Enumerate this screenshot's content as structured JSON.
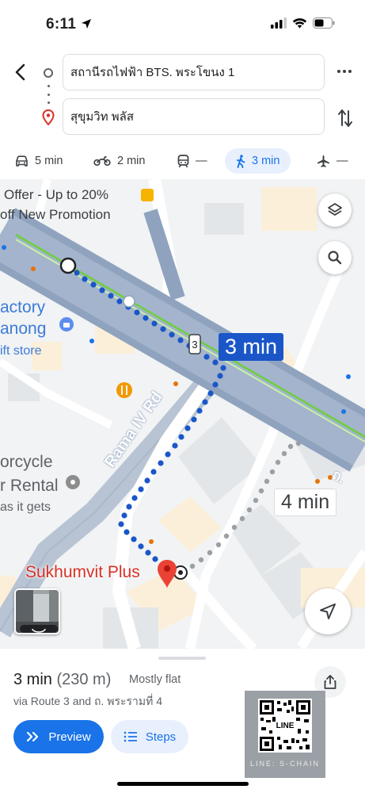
{
  "status": {
    "time": "6:11"
  },
  "directions": {
    "from": "สถานีรถไฟฟ้า BTS. พระโขนง 1",
    "to": "สุขุมวิท พลัส"
  },
  "modes": [
    {
      "name": "drive",
      "label": "5 min",
      "icon": "car-icon"
    },
    {
      "name": "motorcycle",
      "label": "2 min",
      "icon": "motorcycle-icon"
    },
    {
      "name": "transit",
      "label": "—",
      "icon": "train-icon"
    },
    {
      "name": "walk",
      "label": "3 min",
      "icon": "walk-icon",
      "selected": true
    },
    {
      "name": "flight",
      "label": "—",
      "icon": "plane-icon"
    }
  ],
  "map": {
    "labels": {
      "offer_line1": "Offer - Up to 20%",
      "offer_line2": "off New Promotion",
      "factory": "actory",
      "ranong": "anong",
      "gift_store": "ift store",
      "motorcycle": "orcycle",
      "rental": "r Rental",
      "as_it_gets": "as it gets",
      "road_name": "Rama IV Rd",
      "road_thai": "ถ. ",
      "route_marker": "3"
    },
    "route_callout": "3 min",
    "alt_route_callout": "4 min",
    "destination_label": "Sukhumvit Plus",
    "route_color": "#1a56c8"
  },
  "route": {
    "time": "3 min",
    "distance": "(230 m)",
    "description": "Mostly flat",
    "via": "via Route 3 and ถ. พระรามที่ 4"
  },
  "actions": {
    "preview": "Preview",
    "steps": "Steps"
  },
  "watermark": {
    "caption": "LINE: S-CHAIN",
    "qr_label": "LINE"
  }
}
